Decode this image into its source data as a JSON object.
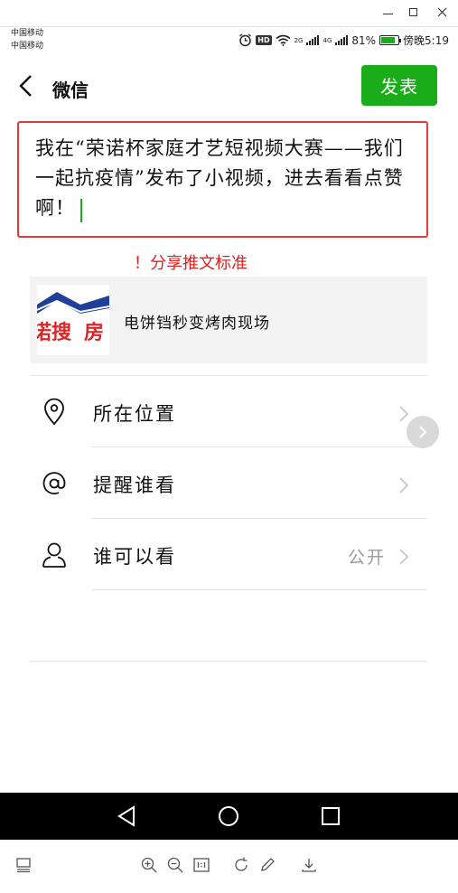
{
  "status_bar": {
    "carrier_1": "中国移动",
    "carrier_2": "中国移动",
    "hd": "HD",
    "net_1": "2G",
    "net_2": "4G",
    "battery": "81%",
    "battery_level": 0.81,
    "time": "傍晚5:19"
  },
  "header": {
    "title": "微信",
    "publish_label": "发表"
  },
  "compose": {
    "text": "我在“荣诺杯家庭才艺短视频大赛——我们一起抗疫情”发布了小视频，进去看看点赞啊！"
  },
  "note": "！分享推文标准",
  "share_card": {
    "title": "电饼铛秒变烤肉现场"
  },
  "options": [
    {
      "label": "所在位置",
      "icon": "location-pin-icon",
      "value": ""
    },
    {
      "label": "提醒谁看",
      "icon": "at-icon",
      "value": ""
    },
    {
      "label": "谁可以看",
      "icon": "person-icon",
      "value": "公开"
    }
  ],
  "colors": {
    "accent_green": "#1aad19",
    "highlight_red": "#e03b3b"
  }
}
